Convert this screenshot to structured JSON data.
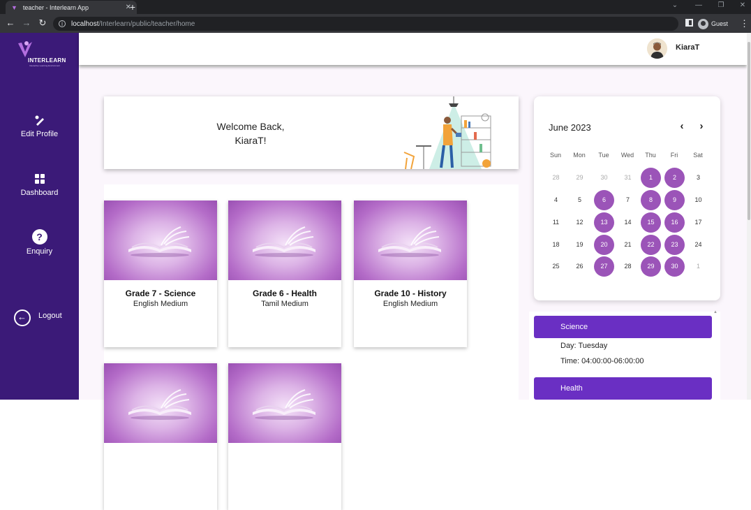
{
  "browser": {
    "tab_title": "teacher - Interlearn App",
    "url_host": "localhost",
    "url_path": "/Interlearn/public/teacher/home",
    "profile_label": "Guest"
  },
  "sidebar": {
    "logo_text": "INTERLEARN",
    "logo_tagline": "Interactive Learning Environment",
    "items": [
      {
        "label": "Edit Profile",
        "icon": "edit-icon"
      },
      {
        "label": "Dashboard",
        "icon": "dashboard-grid-icon"
      },
      {
        "label": "Enquiry",
        "icon": "help-question-icon"
      }
    ],
    "logout_label": "Logout"
  },
  "header": {
    "username": "KiaraT"
  },
  "welcome": {
    "line1": "Welcome Back,",
    "line2": "KiaraT!"
  },
  "courses": [
    {
      "title": "Grade 7 - Science",
      "medium": "English Medium"
    },
    {
      "title": "Grade 6 - Health",
      "medium": "Tamil Medium"
    },
    {
      "title": "Grade 10 - History",
      "medium": "English Medium"
    },
    {
      "title": "",
      "medium": ""
    },
    {
      "title": "",
      "medium": ""
    }
  ],
  "calendar": {
    "month_label": "June 2023",
    "weekdays": [
      "Sun",
      "Mon",
      "Tue",
      "Wed",
      "Thu",
      "Fri",
      "Sat"
    ],
    "weeks": [
      [
        "28",
        "29",
        "30",
        "31",
        "1",
        "2",
        "3"
      ],
      [
        "4",
        "5",
        "6",
        "7",
        "8",
        "9",
        "10"
      ],
      [
        "11",
        "12",
        "13",
        "14",
        "15",
        "16",
        "17"
      ],
      [
        "18",
        "19",
        "20",
        "21",
        "22",
        "23",
        "24"
      ],
      [
        "25",
        "26",
        "27",
        "28",
        "29",
        "30",
        "1"
      ]
    ],
    "muted_days": [
      "28",
      "29",
      "30",
      "31"
    ],
    "muted_trailing": [
      "1"
    ],
    "highlighted_days": [
      "1",
      "2",
      "6",
      "8",
      "9",
      "13",
      "15",
      "16",
      "20",
      "22",
      "23",
      "27",
      "29",
      "30"
    ],
    "highlight_color": "#9b54b8"
  },
  "schedule": [
    {
      "subject": "Science",
      "day": "Day: Tuesday",
      "time": "Time: 04:00:00-06:00:00"
    },
    {
      "subject": "Health"
    }
  ],
  "colors": {
    "sidebar_bg": "#3b1a78",
    "accent": "#6a2fc3"
  }
}
